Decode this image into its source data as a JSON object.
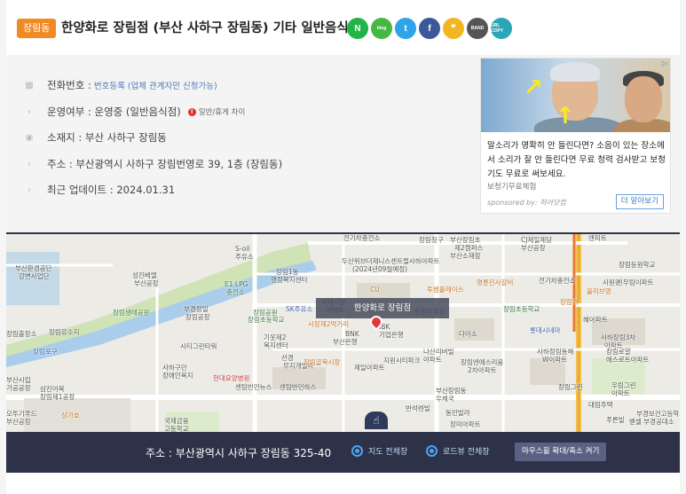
{
  "header": {
    "category": "장림동",
    "title": "한양화로 장림점 (부산 사하구 장림동) 기타 일반음식점"
  },
  "share": [
    {
      "name": "naver",
      "label": "N",
      "color": "#21b548"
    },
    {
      "name": "blog",
      "label": "blog",
      "color": "#46b842"
    },
    {
      "name": "twitter",
      "label": "t",
      "color": "#2fa3e8"
    },
    {
      "name": "facebook",
      "label": "f",
      "color": "#3b5998"
    },
    {
      "name": "kakaostory",
      "label": "❞",
      "color": "#f2b620"
    },
    {
      "name": "band",
      "label": "BAND",
      "color": "#555555"
    },
    {
      "name": "url-copy",
      "label": "URL COPY",
      "color": "#2aa6b8"
    }
  ],
  "info": {
    "phone_label": "전화번호 : ",
    "phone_value": "번호등록 (업체 관계자만 신청가능)",
    "status_label": "운영여부 : 운영중 (일반음식점)",
    "status_note": "일반/휴게 차이",
    "location": "소재지 : 부산 사하구 장림동",
    "address": "주소 : 부산광역시 사하구 장림번영로 39, 1층 (장림동)",
    "updated": "최근 업데이트 : 2024.01.31"
  },
  "ad": {
    "text": "말소리가 명확히 안 들린다면? 소음이 있는 장소에서 소리가 잘 안 들린다면 무료 청력 검사받고 보청기도 무료로 써보세요.",
    "source": "보청기무료체험",
    "sponsored": "sponsored by: 히어닷컴",
    "button": "더 알아보기"
  },
  "map": {
    "tooltip": "한양화로 장림점",
    "labels": [
      {
        "t": "부산환경공단",
        "c": ""
      },
      {
        "t": "강변사업단",
        "c": ""
      },
      {
        "t": "성진베엘",
        "c": ""
      },
      {
        "t": "부산공장",
        "c": ""
      },
      {
        "t": "S-oil",
        "c": ""
      },
      {
        "t": "주유소",
        "c": ""
      },
      {
        "t": "E1 LPG",
        "c": "g"
      },
      {
        "t": "충전소",
        "c": "g"
      },
      {
        "t": "장림생태공원",
        "c": "g"
      },
      {
        "t": "부경정밀",
        "c": ""
      },
      {
        "t": "장림공장",
        "c": ""
      },
      {
        "t": "장림유수지",
        "c": ""
      },
      {
        "t": "장림출장소",
        "c": ""
      },
      {
        "t": "장림포구",
        "c": "b"
      },
      {
        "t": "시티그린타워",
        "c": ""
      },
      {
        "t": "사하구민",
        "c": ""
      },
      {
        "t": "장애인복지",
        "c": ""
      },
      {
        "t": "부산시립",
        "c": ""
      },
      {
        "t": "가공공장",
        "c": ""
      },
      {
        "t": "삼진어묵",
        "c": ""
      },
      {
        "t": "장림제1공장",
        "c": ""
      },
      {
        "t": "오뚜기푸드",
        "c": ""
      },
      {
        "t": "부산공장",
        "c": ""
      },
      {
        "t": "국제금융",
        "c": ""
      },
      {
        "t": "고등학교",
        "c": ""
      },
      {
        "t": "상가호",
        "c": "o"
      },
      {
        "t": "현대요양병원",
        "c": "r"
      },
      {
        "t": "센텀빈민뉴스",
        "c": ""
      },
      {
        "t": "장림초등학교",
        "c": "g"
      },
      {
        "t": "장림1동",
        "c": ""
      },
      {
        "t": "행정복지센터",
        "c": ""
      },
      {
        "t": "SK주유소",
        "c": "b"
      },
      {
        "t": "장림공원",
        "c": "g"
      },
      {
        "t": "국제시장",
        "c": ""
      },
      {
        "t": "아파트",
        "c": ""
      },
      {
        "t": "시장제2먹거리",
        "c": "o"
      },
      {
        "t": "기웃제2",
        "c": ""
      },
      {
        "t": "복지센터",
        "c": ""
      },
      {
        "t": "BNK",
        "c": ""
      },
      {
        "t": "부산은행",
        "c": ""
      },
      {
        "t": "IBK",
        "c": ""
      },
      {
        "t": "기업은행",
        "c": ""
      },
      {
        "t": "선경",
        "c": ""
      },
      {
        "t": "무지개빌라",
        "c": ""
      },
      {
        "t": "장림골목시장",
        "c": "o"
      },
      {
        "t": "제일아파트",
        "c": ""
      },
      {
        "t": "지원시티파크",
        "c": ""
      },
      {
        "t": "센텀반민하스",
        "c": ""
      },
      {
        "t": "두산위브더제니스센트럴사하아파트",
        "c": ""
      },
      {
        "t": "(2024년09월예정)",
        "c": ""
      },
      {
        "t": "CU",
        "c": "o"
      },
      {
        "t": "투썸플레이스",
        "c": "o"
      },
      {
        "t": "동원주유소",
        "c": "b"
      },
      {
        "t": "나산리버빌",
        "c": ""
      },
      {
        "t": "아파트",
        "c": ""
      },
      {
        "t": "다이소",
        "c": ""
      },
      {
        "t": "명륜진사갈비",
        "c": "o"
      },
      {
        "t": "장림초등학교",
        "c": "g"
      },
      {
        "t": "롯데시네마",
        "c": "b"
      },
      {
        "t": "장림엔에스리움",
        "c": ""
      },
      {
        "t": "2차아파트",
        "c": ""
      },
      {
        "t": "부산장림동",
        "c": ""
      },
      {
        "t": "우체국",
        "c": ""
      },
      {
        "t": "동민빌라",
        "c": ""
      },
      {
        "t": "부산장림초",
        "c": ""
      },
      {
        "t": "제2캠퍼스",
        "c": ""
      },
      {
        "t": "부산소재참",
        "c": ""
      },
      {
        "t": "장림청구",
        "c": ""
      },
      {
        "t": "CJ제일제당",
        "c": ""
      },
      {
        "t": "부산공장",
        "c": ""
      },
      {
        "t": "전기차충전소",
        "c": ""
      },
      {
        "t": "올리브영",
        "c": "o"
      },
      {
        "t": "사원원",
        "c": ""
      },
      {
        "t": "신무림이파트",
        "c": ""
      },
      {
        "t": "장림역",
        "c": "o"
      },
      {
        "t": "혜아파트",
        "c": ""
      },
      {
        "t": "사하장림3차",
        "c": ""
      },
      {
        "t": "아파트",
        "c": ""
      },
      {
        "t": "사하정림동해",
        "c": ""
      },
      {
        "t": "W이파트",
        "c": ""
      },
      {
        "t": "장림그린",
        "c": ""
      },
      {
        "t": "장림로얄",
        "c": ""
      },
      {
        "t": "에스로트아파트",
        "c": ""
      },
      {
        "t": "우림그린",
        "c": ""
      },
      {
        "t": "아파트",
        "c": ""
      },
      {
        "t": "대림주택",
        "c": ""
      },
      {
        "t": "푸른빌",
        "c": ""
      },
      {
        "t": "부경보건고등학교",
        "c": ""
      },
      {
        "t": "벧셀 부경공대소",
        "c": ""
      },
      {
        "t": "반석렌빌",
        "c": ""
      },
      {
        "t": "장미아파트",
        "c": ""
      },
      {
        "t": "앤피트",
        "c": ""
      },
      {
        "t": "장림등원학교",
        "c": ""
      },
      {
        "t": "전기차충전소",
        "c": ""
      }
    ]
  },
  "footer": {
    "address": "주소 : 부산광역시 사하구 장림동 325-40",
    "map_full": "지도 전체창",
    "roadview_full": "로드뷰 전체창",
    "zoom": "마우스휠 확대/축소 켜기"
  }
}
